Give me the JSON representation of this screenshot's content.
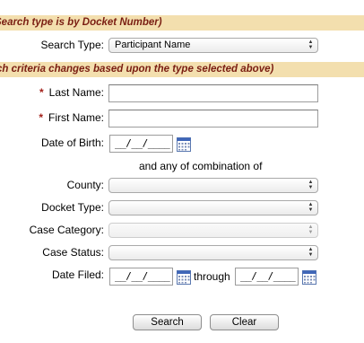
{
  "banners": {
    "top": "Search type is by Docket Number)",
    "criteria": "ch criteria changes based upon the type selected above)"
  },
  "search_type": {
    "label": "Search Type:",
    "value": "Participant Name"
  },
  "last_name": {
    "required_mark": "*",
    "label": "Last Name:",
    "value": ""
  },
  "first_name": {
    "required_mark": "*",
    "label": "First Name:",
    "value": ""
  },
  "dob": {
    "label": "Date of Birth:",
    "value": "__/__/____"
  },
  "combination_text": "and any of combination of",
  "county": {
    "label": "County:",
    "value": ""
  },
  "docket_type": {
    "label": "Docket Type:",
    "value": ""
  },
  "case_category": {
    "label": "Case Category:",
    "value": ""
  },
  "case_status": {
    "label": "Case Status:",
    "value": ""
  },
  "date_filed": {
    "label": "Date Filed:",
    "from_value": "__/__/____",
    "through_label": "through",
    "to_value": "__/__/____"
  },
  "buttons": {
    "search": "Search",
    "clear": "Clear"
  },
  "icons": {
    "calendar": "calendar-icon",
    "select_arrows": "up-down-arrows-icon"
  },
  "colors": {
    "banner_bg": "#f3dfae",
    "banner_text": "#7a1e12",
    "required": "#a3201a"
  }
}
